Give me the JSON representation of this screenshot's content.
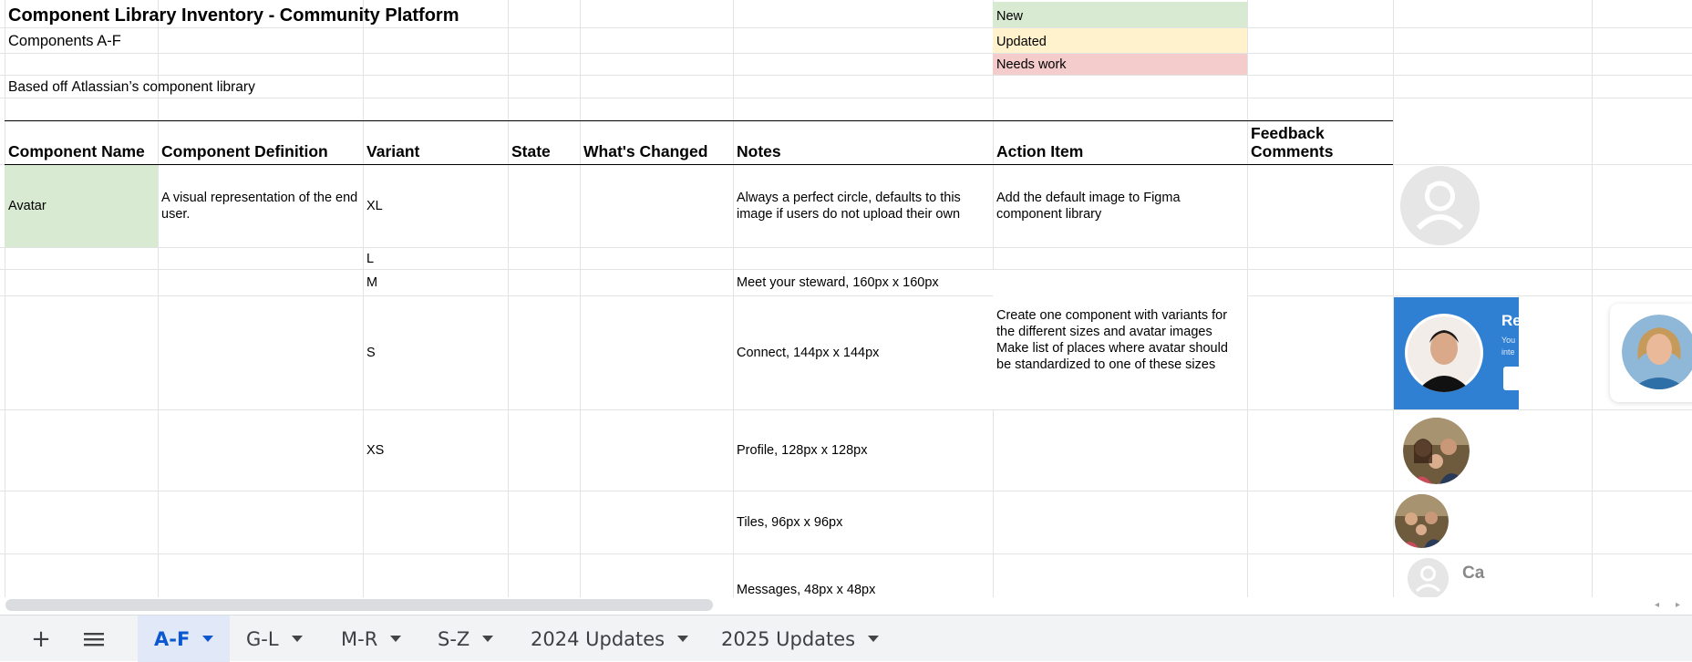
{
  "sheet": {
    "title": "Component Library Inventory - Community Platform",
    "subtitle": "Components A-F",
    "based_prefix": "Based off ",
    "based_link": "Atlassian’s component library"
  },
  "legend": {
    "new": "New",
    "updated": "Updated",
    "needs_work": "Needs work",
    "new_color": "#d9ead3",
    "updated_color": "#fff2cc",
    "needs_work_color": "#f4cccc"
  },
  "headers": {
    "component_name": "Component Name",
    "component_definition": "Component Definition",
    "variant": "Variant",
    "state": "State",
    "whats_changed": "What's Changed",
    "notes": "Notes",
    "action_item": "Action Item",
    "feedback_line1": "Feedback",
    "feedback_line2": "Comments"
  },
  "rows": {
    "avatar_name": "Avatar",
    "avatar_definition": "A visual representation of the end user.",
    "xl_variant": "XL",
    "xl_notes": "Always a perfect circle, defaults to this image if users do not upload their own",
    "xl_action": "Add the default image to Figma component library",
    "l_variant": "L",
    "m_variant": "M",
    "m_notes": "Meet your steward, 160px x 160px",
    "s_variant": "S",
    "s_notes": "Connect, 144px x 144px",
    "s_action": "Create one component with variants for the different sizes and avatar images Make list of places where avatar should be standardized to one of these sizes",
    "xs_variant": "XS",
    "xs_notes": "Profile, 128px x 128px",
    "tiles_notes": "Tiles, 96px x 96px",
    "messages_notes": "Messages, 48px x 48px"
  },
  "preview": {
    "card_title_partial": "Re",
    "card_text_1": "You",
    "card_text_2": "inte",
    "small_name_partial": "Ca"
  },
  "tabs": [
    {
      "label": "A-F",
      "active": true
    },
    {
      "label": "G-L"
    },
    {
      "label": "M-R"
    },
    {
      "label": "S-Z"
    },
    {
      "label": "2024 Updates"
    },
    {
      "label": "2025 Updates"
    }
  ],
  "toolbar": {
    "add_sheet": "+",
    "all_sheets": "≡"
  },
  "colors": {
    "card_blue": "#2f80d2",
    "tab_active_text": "#0b57d0",
    "tab_active_bg": "#e1e9f8"
  }
}
